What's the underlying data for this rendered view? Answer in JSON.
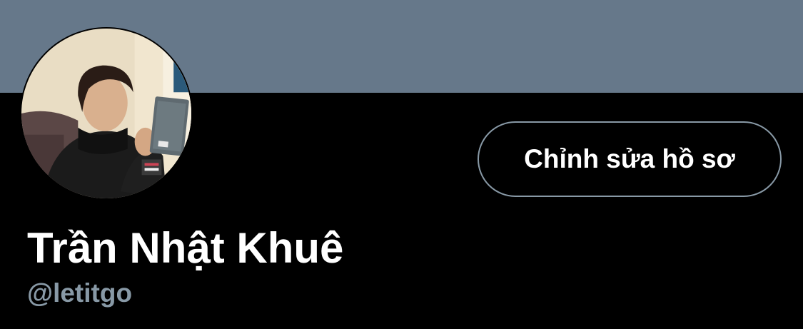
{
  "profile": {
    "display_name": "Trần Nhật Khuê",
    "handle": "@letitgo",
    "edit_button_label": "Chỉnh sửa hồ sơ",
    "avatar_icon": "profile-photo"
  },
  "colors": {
    "banner": "#66788a",
    "background": "#000000",
    "text_primary": "#ffffff",
    "text_secondary": "#8899a6",
    "button_border": "#8899a6"
  }
}
